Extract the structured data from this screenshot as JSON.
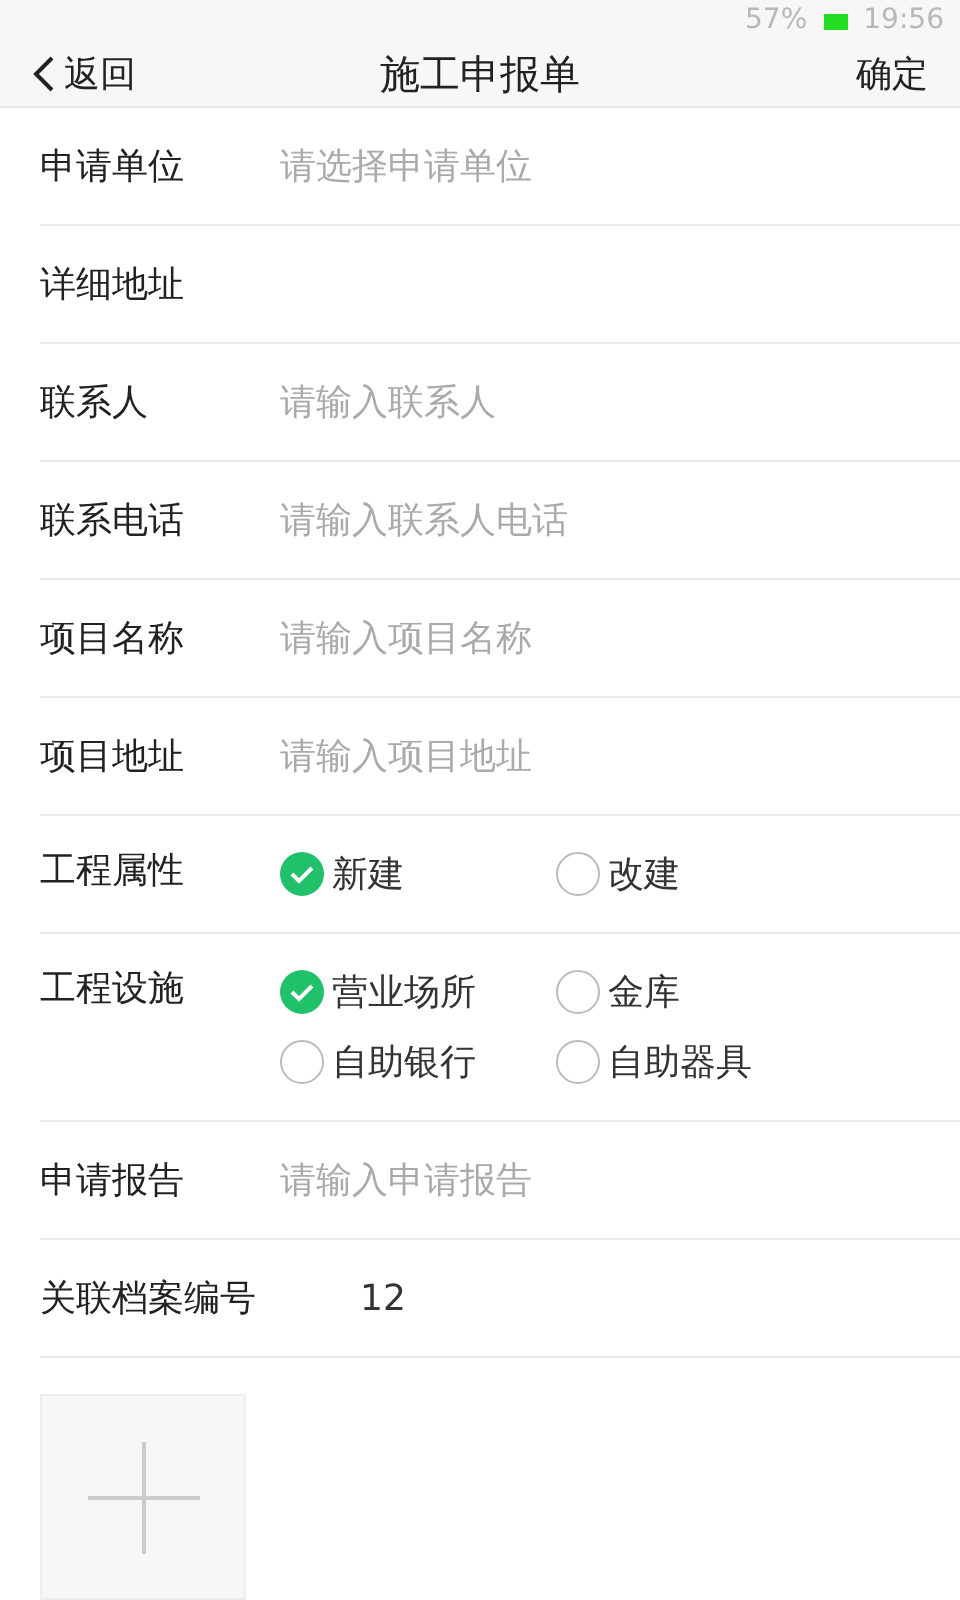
{
  "status_bar": {
    "battery": "57%",
    "time": "19:56"
  },
  "nav": {
    "back": "返回",
    "title": "施工申报单",
    "confirm": "确定"
  },
  "fields": [
    {
      "kind": "select",
      "label": "申请单位",
      "placeholder": "请选择申请单位"
    },
    {
      "kind": "input",
      "label": "详细地址"
    },
    {
      "kind": "input",
      "label": "联系人",
      "placeholder": "请输入联系人"
    },
    {
      "kind": "input",
      "label": "联系电话",
      "placeholder": "请输入联系人电话"
    },
    {
      "kind": "input",
      "label": "项目名称",
      "placeholder": "请输入项目名称"
    },
    {
      "kind": "input",
      "label": "项目地址",
      "placeholder": "请输入项目地址"
    },
    {
      "kind": "options",
      "label": "工程属性",
      "options": [
        {
          "label": "新建",
          "checked": true
        },
        {
          "label": "改建",
          "checked": false
        }
      ]
    },
    {
      "kind": "options",
      "label": "工程设施",
      "options": [
        {
          "label": "营业场所",
          "checked": true
        },
        {
          "label": "金库",
          "checked": false
        },
        {
          "label": "自助银行",
          "checked": false
        },
        {
          "label": "自助器具",
          "checked": false
        }
      ]
    },
    {
      "kind": "input",
      "label": "申请报告",
      "placeholder": "请输入申请报告"
    },
    {
      "kind": "input",
      "label": "关联档案编号",
      "value": "12"
    }
  ]
}
